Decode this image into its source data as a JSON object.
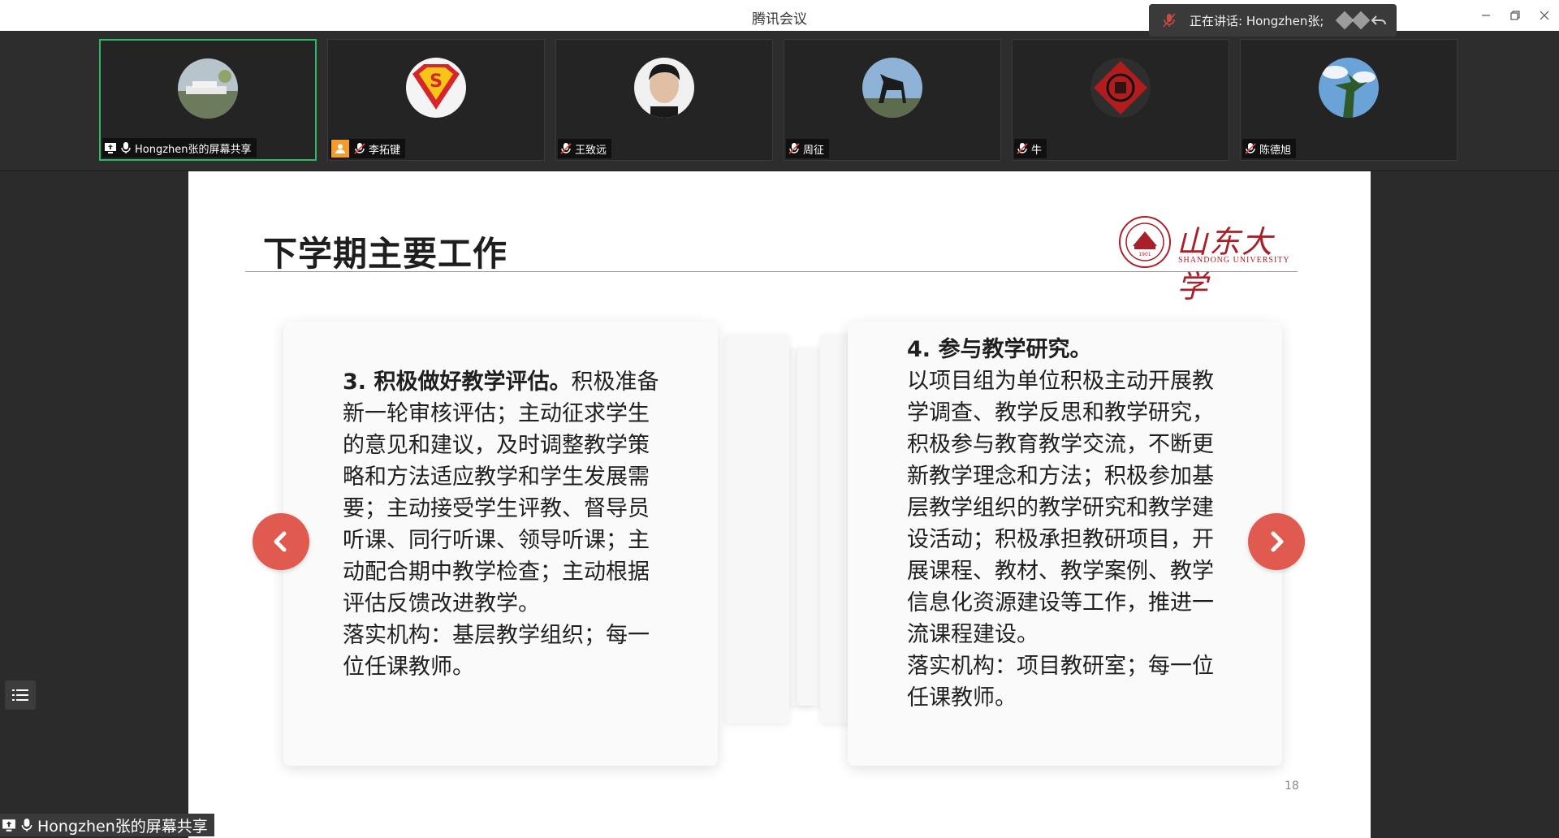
{
  "app": {
    "title": "腾讯会议"
  },
  "speaking": {
    "text": "正在讲话: Hongzhen张;"
  },
  "participants": [
    {
      "name": "Hongzhen张的屏幕共享",
      "active": true
    },
    {
      "name": "李拓键"
    },
    {
      "name": "王致远"
    },
    {
      "name": "周征"
    },
    {
      "name": "牛"
    },
    {
      "name": "陈德旭"
    }
  ],
  "slide": {
    "title": "下学期主要工作",
    "logo_cn": "山东大学",
    "logo_en": "SHANDONG UNIVERSITY",
    "page_number": "18",
    "card_left": {
      "heading": "3. 积极做好教学评估。",
      "lines": [
        "积极准备",
        "新一轮审核评估；主动征求学生",
        "的意见和建议，及时调整教学策",
        "略和方法适应教学和学生发展需",
        "要；主动接受学生评教、督导员",
        "听课、同行听课、领导听课；主",
        "动配合期中教学检查；主动根据",
        "评估反馈改进教学。",
        "落实机构：基层教学组织；每一",
        "位任课教师。"
      ]
    },
    "card_right": {
      "heading": "4. 参与教学研究。",
      "lines": [
        "以项目组为单位积极主动开展教",
        "学调查、教学反思和教学研究，",
        "积极参与教育教学交流，不断更",
        "新教学理念和方法；积极参加基",
        "层教学组织的教学研究和教学建",
        "设活动；积极承担教研项目，开",
        "展课程、教材、教学案例、教学",
        "信息化资源建设等工作，推进一",
        "流课程建设。",
        "落实机构：项目教研室；每一位",
        "任课教师。"
      ]
    }
  },
  "share_label": "Hongzhen张的屏幕共享",
  "colors": {
    "accent_red": "#e05a50",
    "active_green": "#2fb86a",
    "logo_red": "#a8202a"
  }
}
